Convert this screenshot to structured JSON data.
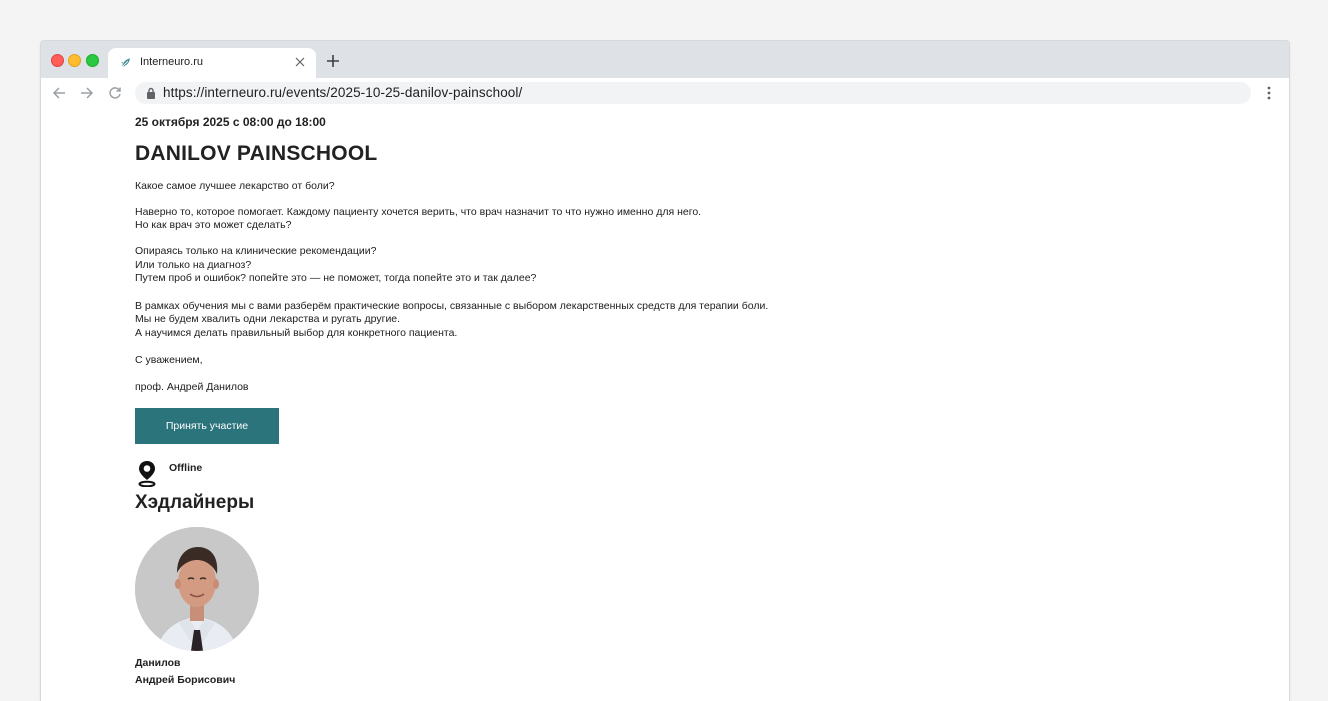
{
  "browser": {
    "tab_title": "Interneuro.ru",
    "url": "https://interneuro.ru/events/2025-10-25-danilov-painschool/"
  },
  "event": {
    "date": "25 октября 2025 с 08:00 до 18:00",
    "title": "DANILOV PAINSCHOOL",
    "paragraphs": [
      "Какое самое лучшее лекарство от боли?",
      "Наверно то, которое помогает. Каждому пациенту хочется верить, что врач назначит то что нужно именно для него.",
      "Но как врач это может сделать?",
      "Опираясь только на клинические рекомендации?",
      "Или только на диагноз?",
      "Путем проб и ошибок? попейте это — не поможет, тогда попейте это и так далее?",
      "В рамках обучения мы с вами разберём практические вопросы, связанные с выбором лекарственных средств для терапии боли.",
      "Мы не будем хвалить одни лекарства и ругать другие.",
      "А научимся делать правильный выбор для конкретного пациента.",
      "С уважением,",
      "проф. Андрей Данилов"
    ],
    "cta_label": "Принять участие",
    "format": "Offline"
  },
  "headliners": {
    "heading": "Хэдлайнеры",
    "speakers": [
      {
        "surname": "Данилов",
        "given": "Андрей Борисович"
      }
    ]
  },
  "colors": {
    "accent": "#2c747c",
    "tabstrip": "#dee1e6",
    "omnibox": "#f1f3f4"
  },
  "icons": {
    "tab_favicon": "leaf-icon",
    "tab_close": "close-icon",
    "new_tab": "plus-icon",
    "back": "arrow-left-icon",
    "forward": "arrow-right-icon",
    "reload": "reload-icon",
    "lock": "lock-icon",
    "menu": "kebab-menu-icon",
    "location": "map-pin-icon"
  }
}
